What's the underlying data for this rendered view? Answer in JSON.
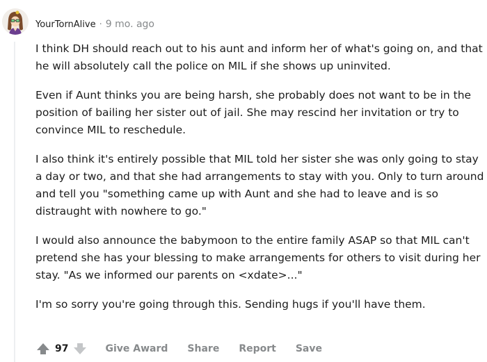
{
  "comment": {
    "author": "YourTornAlive",
    "separator": "·",
    "time": "9 mo. ago",
    "paragraphs": [
      "I think DH should reach out to his aunt and inform her of what's going on, and that he will absolutely call the police on MIL if she shows up uninvited.",
      "Even if Aunt thinks you are being harsh, she probably does not want to be in the position of bailing her sister out of jail. She may rescind her invitation or try to convince MIL to reschedule.",
      "I also think it's entirely possible that MIL told her sister she was only going to stay a day or two, and that she had arrangements to stay with you. Only to turn around and tell you \"something came up with Aunt and she had to leave and is so distraught with nowhere to go.\"",
      "I would also announce the babymoon to the entire family ASAP so that MIL can't pretend she has your blessing to make arrangements for others to visit during her stay. \"As we informed our parents on <xdate>...\"",
      "I'm so sorry you're going through this. Sending hugs if you'll have them."
    ]
  },
  "actions": {
    "score": "97",
    "give_award": "Give Award",
    "share": "Share",
    "report": "Report",
    "save": "Save"
  },
  "icons": {
    "avatar": "avatar-image",
    "upvote": "upvote-arrow-icon",
    "downvote": "downvote-arrow-icon"
  },
  "colors": {
    "text": "#1c1c1c",
    "meta": "#878a8c",
    "thread_line": "#edeff1"
  }
}
